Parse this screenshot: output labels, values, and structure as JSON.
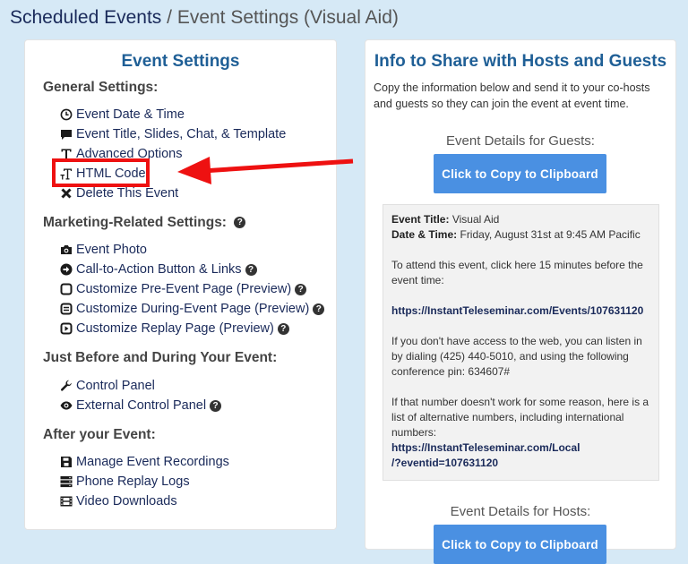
{
  "breadcrumb": {
    "root": "Scheduled Events",
    "separator": " / ",
    "current": "Event Settings (Visual Aid)"
  },
  "left": {
    "title": "Event Settings",
    "sections": {
      "general": {
        "title": "General Settings:",
        "items": [
          {
            "label": "Event Date & Time",
            "icon": "clock-icon"
          },
          {
            "label": "Event Title, Slides, Chat, & Template",
            "icon": "comment-icon"
          },
          {
            "label": "Advanced Options",
            "icon": "text-t-icon"
          },
          {
            "label": "HTML Code",
            "icon": "text-height-icon"
          },
          {
            "label": "Delete This Event",
            "icon": "x-icon"
          }
        ]
      },
      "marketing": {
        "title": "Marketing-Related Settings:",
        "items": [
          {
            "label": "Event Photo",
            "icon": "camera-icon"
          },
          {
            "label": "Call-to-Action Button & Links",
            "icon": "arrow-circle-right-icon"
          },
          {
            "label": "Customize Pre-Event Page (Preview)",
            "icon": "square-icon"
          },
          {
            "label": "Customize During-Event Page (Preview)",
            "icon": "square-lines-icon"
          },
          {
            "label": "Customize Replay Page (Preview)",
            "icon": "play-square-icon"
          }
        ]
      },
      "during": {
        "title": "Just Before and During Your Event:",
        "items": [
          {
            "label": "Control Panel",
            "icon": "wrench-icon"
          },
          {
            "label": "External Control Panel",
            "icon": "eye-icon"
          }
        ]
      },
      "after": {
        "title": "After your Event:",
        "items": [
          {
            "label": "Manage Event Recordings",
            "icon": "save-icon"
          },
          {
            "label": "Phone Replay Logs",
            "icon": "server-icon"
          },
          {
            "label": "Video Downloads",
            "icon": "film-icon"
          }
        ]
      }
    },
    "help_glyph": "?"
  },
  "right": {
    "title": "Info to Share with Hosts and Guests",
    "intro": "Copy the information below and send it to your co-hosts and guests so they can join the event at event time.",
    "guests_heading": "Event Details for Guests:",
    "copy_button": "Click to Copy to Clipboard",
    "details": {
      "title_label": "Event Title:",
      "title_value": "Visual Aid",
      "datetime_label": "Date & Time:",
      "datetime_value": "Friday, August 31st at 9:45 AM Pacific",
      "attend_text": "To attend this event, click here 15 minutes before the event time:",
      "event_url": "https://InstantTeleseminar.com/Events/107631120",
      "phone_text": "If you don't have access to the web, you can listen in by dialing (425) 440-5010, and using the following conference pin: 634607#",
      "alt_text": "If that number doesn't work for some reason, here is a list of alternative numbers, including international numbers:",
      "alt_url_line1": "https://InstantTeleseminar.com/Local",
      "alt_url_line2": "/?eventid=107631120"
    },
    "hosts_heading": "Event Details for Hosts:",
    "hosts_copy_button": "Click to Copy to Clipboard"
  },
  "colors": {
    "page_bg": "#d6e9f6",
    "title_blue": "#1f5f96",
    "link_navy": "#1a2a5a",
    "button_blue": "#4a90e2",
    "highlight_red": "#ee1111"
  }
}
